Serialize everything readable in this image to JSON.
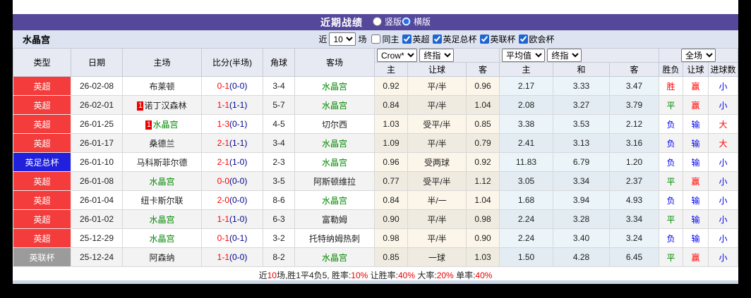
{
  "colors": {
    "header_purple": "#55489b",
    "filter_bg": "#dee3f2",
    "league": {
      "red": "#f43c3c",
      "blue": "#2020dd",
      "gray": "#9b9b9b"
    },
    "team_green": "#008800",
    "score_fulltime_red": "#ff0000",
    "score_halftime_navy": "#00008b",
    "result": {
      "red": "#ff0000",
      "green": "#008800",
      "blue": "#0000ee"
    }
  },
  "title_bar": {
    "title": "近期战绩",
    "radios": [
      {
        "label": "竖版",
        "selected": false
      },
      {
        "label": "横版",
        "selected": true
      }
    ]
  },
  "filter_bar": {
    "team": "水晶宫",
    "recent_label": "近",
    "matches_select": "10",
    "matches_label": "场",
    "checkboxes": [
      {
        "label": "同主",
        "checked": false
      },
      {
        "label": "英超",
        "checked": true
      },
      {
        "label": "英足总杯",
        "checked": true
      },
      {
        "label": "英联杯",
        "checked": true
      },
      {
        "label": "欧会杯",
        "checked": true
      }
    ]
  },
  "table": {
    "left_headers": [
      "类型",
      "日期",
      "主场",
      "比分(半场)",
      "角球",
      "客场"
    ],
    "groups": [
      {
        "selects": [
          "Crow*",
          "终指"
        ],
        "sub": [
          "主",
          "让球",
          "客"
        ]
      },
      {
        "selects": [
          "平均值",
          "终指"
        ],
        "sub": [
          "主",
          "和",
          "客"
        ]
      },
      {
        "selects": [
          "全场"
        ],
        "sub": [
          "胜负",
          "让球",
          "进球数"
        ]
      }
    ],
    "rows": [
      {
        "league": "英超",
        "league_color": "red",
        "date": "26-02-08",
        "home": {
          "name": "布莱顿",
          "green": false,
          "badge": ""
        },
        "score": {
          "ft": "0-1",
          "ht": "(0-0)"
        },
        "corner": "3-4",
        "away": {
          "name": "水晶宫",
          "green": true,
          "badge": ""
        },
        "odds_asia": [
          "0.92",
          "平/半",
          "0.96"
        ],
        "odds_euro": [
          "2.17",
          "3.33",
          "3.47"
        ],
        "result": {
          "wdl": "胜",
          "wdl_color": "red",
          "handicap": "赢",
          "handicap_color": "red",
          "goals": "小",
          "goals_color": "blue"
        }
      },
      {
        "league": "英超",
        "league_color": "red",
        "date": "26-02-01",
        "home": {
          "name": "诺丁汉森林",
          "green": false,
          "badge": "1"
        },
        "score": {
          "ft": "1-1",
          "ht": "(1-1)"
        },
        "corner": "5-7",
        "away": {
          "name": "水晶宫",
          "green": true,
          "badge": ""
        },
        "odds_asia": [
          "0.84",
          "平/半",
          "1.04"
        ],
        "odds_euro": [
          "2.08",
          "3.27",
          "3.79"
        ],
        "result": {
          "wdl": "平",
          "wdl_color": "green",
          "handicap": "赢",
          "handicap_color": "red",
          "goals": "小",
          "goals_color": "blue"
        }
      },
      {
        "league": "英超",
        "league_color": "red",
        "date": "26-01-25",
        "home": {
          "name": "水晶宫",
          "green": true,
          "badge": "1"
        },
        "score": {
          "ft": "1-3",
          "ht": "(0-1)"
        },
        "corner": "4-5",
        "away": {
          "name": "切尔西",
          "green": false,
          "badge": ""
        },
        "odds_asia": [
          "1.03",
          "受平/半",
          "0.85"
        ],
        "odds_euro": [
          "3.38",
          "3.53",
          "2.12"
        ],
        "result": {
          "wdl": "负",
          "wdl_color": "blue",
          "handicap": "输",
          "handicap_color": "blue",
          "goals": "大",
          "goals_color": "red"
        }
      },
      {
        "league": "英超",
        "league_color": "red",
        "date": "26-01-17",
        "home": {
          "name": "桑德兰",
          "green": false,
          "badge": ""
        },
        "score": {
          "ft": "2-1",
          "ht": "(1-1)"
        },
        "corner": "3-4",
        "away": {
          "name": "水晶宫",
          "green": true,
          "badge": ""
        },
        "odds_asia": [
          "1.09",
          "平/半",
          "0.79"
        ],
        "odds_euro": [
          "2.41",
          "3.13",
          "3.16"
        ],
        "result": {
          "wdl": "负",
          "wdl_color": "blue",
          "handicap": "输",
          "handicap_color": "blue",
          "goals": "大",
          "goals_color": "red"
        }
      },
      {
        "league": "英足总杯",
        "league_color": "blue",
        "date": "26-01-10",
        "home": {
          "name": "马科斯菲尔德",
          "green": false,
          "badge": ""
        },
        "score": {
          "ft": "2-1",
          "ht": "(1-0)"
        },
        "corner": "2-3",
        "away": {
          "name": "水晶宫",
          "green": true,
          "badge": ""
        },
        "odds_asia": [
          "0.96",
          "受两球",
          "0.92"
        ],
        "odds_euro": [
          "11.83",
          "6.79",
          "1.20"
        ],
        "result": {
          "wdl": "负",
          "wdl_color": "blue",
          "handicap": "输",
          "handicap_color": "blue",
          "goals": "小",
          "goals_color": "blue"
        }
      },
      {
        "league": "英超",
        "league_color": "red",
        "date": "26-01-08",
        "home": {
          "name": "水晶宫",
          "green": true,
          "badge": ""
        },
        "score": {
          "ft": "0-0",
          "ht": "(0-0)"
        },
        "corner": "3-5",
        "away": {
          "name": "阿斯顿维拉",
          "green": false,
          "badge": ""
        },
        "odds_asia": [
          "0.77",
          "受平/半",
          "1.12"
        ],
        "odds_euro": [
          "3.05",
          "3.34",
          "2.37"
        ],
        "result": {
          "wdl": "平",
          "wdl_color": "green",
          "handicap": "赢",
          "handicap_color": "red",
          "goals": "小",
          "goals_color": "blue"
        }
      },
      {
        "league": "英超",
        "league_color": "red",
        "date": "26-01-04",
        "home": {
          "name": "纽卡斯尔联",
          "green": false,
          "badge": ""
        },
        "score": {
          "ft": "2-0",
          "ht": "(0-0)"
        },
        "corner": "8-6",
        "away": {
          "name": "水晶宫",
          "green": true,
          "badge": ""
        },
        "odds_asia": [
          "0.84",
          "半/一",
          "1.04"
        ],
        "odds_euro": [
          "1.68",
          "3.94",
          "4.93"
        ],
        "result": {
          "wdl": "负",
          "wdl_color": "blue",
          "handicap": "输",
          "handicap_color": "blue",
          "goals": "小",
          "goals_color": "blue"
        }
      },
      {
        "league": "英超",
        "league_color": "red",
        "date": "26-01-02",
        "home": {
          "name": "水晶宫",
          "green": true,
          "badge": ""
        },
        "score": {
          "ft": "1-1",
          "ht": "(1-0)"
        },
        "corner": "6-3",
        "away": {
          "name": "富勒姆",
          "green": false,
          "badge": ""
        },
        "odds_asia": [
          "0.90",
          "平/半",
          "0.98"
        ],
        "odds_euro": [
          "2.24",
          "3.28",
          "3.34"
        ],
        "result": {
          "wdl": "平",
          "wdl_color": "green",
          "handicap": "输",
          "handicap_color": "blue",
          "goals": "小",
          "goals_color": "blue"
        }
      },
      {
        "league": "英超",
        "league_color": "red",
        "date": "25-12-29",
        "home": {
          "name": "水晶宫",
          "green": true,
          "badge": ""
        },
        "score": {
          "ft": "0-1",
          "ht": "(0-1)"
        },
        "corner": "3-2",
        "away": {
          "name": "托特纳姆热刺",
          "green": false,
          "badge": ""
        },
        "odds_asia": [
          "0.98",
          "平/半",
          "0.90"
        ],
        "odds_euro": [
          "2.24",
          "3.40",
          "3.24"
        ],
        "result": {
          "wdl": "负",
          "wdl_color": "blue",
          "handicap": "输",
          "handicap_color": "blue",
          "goals": "小",
          "goals_color": "blue"
        }
      },
      {
        "league": "英联杯",
        "league_color": "gray",
        "date": "25-12-24",
        "home": {
          "name": "阿森纳",
          "green": false,
          "badge": ""
        },
        "score": {
          "ft": "1-1",
          "ht": "(0-0)"
        },
        "corner": "8-2",
        "away": {
          "name": "水晶宫",
          "green": true,
          "badge": ""
        },
        "odds_asia": [
          "0.85",
          "一球",
          "1.03"
        ],
        "odds_euro": [
          "1.50",
          "4.28",
          "6.45"
        ],
        "result": {
          "wdl": "平",
          "wdl_color": "green",
          "handicap": "赢",
          "handicap_color": "red",
          "goals": "小",
          "goals_color": "blue"
        }
      }
    ]
  },
  "footer": {
    "segments": [
      {
        "text": "近",
        "red": false
      },
      {
        "text": "10",
        "red": true
      },
      {
        "text": "场,胜1平4负5, 胜率:",
        "red": false
      },
      {
        "text": "10%",
        "red": true
      },
      {
        "text": " 让胜率:",
        "red": false
      },
      {
        "text": "40%",
        "red": true
      },
      {
        "text": " 大率:",
        "red": false
      },
      {
        "text": "20%",
        "red": true
      },
      {
        "text": " 单率:",
        "red": false
      },
      {
        "text": "40%",
        "red": true
      }
    ]
  }
}
